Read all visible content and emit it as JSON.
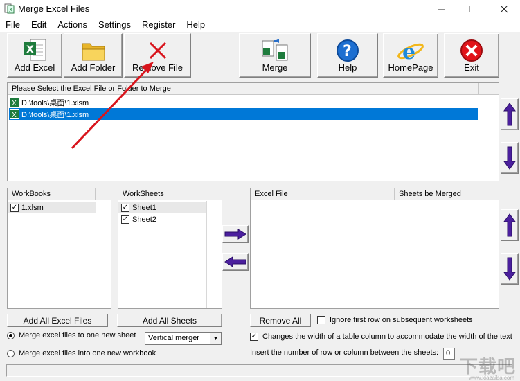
{
  "window": {
    "title": "Merge Excel Files"
  },
  "menu": [
    "File",
    "Edit",
    "Actions",
    "Settings",
    "Register",
    "Help"
  ],
  "toolbar": {
    "add_excel": "Add Excel",
    "add_folder": "Add Folder",
    "remove_file": "Remove File",
    "merge": "Merge",
    "help": "Help",
    "homepage": "HomePage",
    "exit": "Exit"
  },
  "files_panel": {
    "header": "Please Select the Excel File or Folder to Merge",
    "rows": [
      "D:\\tools\\桌面\\1.xlsm",
      "D:\\tools\\桌面\\1.xlsm"
    ],
    "selected_index": 1
  },
  "workbooks": {
    "header": "WorkBooks",
    "rows": [
      "1.xlsm"
    ]
  },
  "worksheets": {
    "header": "WorkSheets",
    "rows": [
      "Sheet1",
      "Sheet2"
    ]
  },
  "merge_list": {
    "col1": "Excel File",
    "col2": "Sheets be Merged"
  },
  "buttons": {
    "add_all_excel": "Add All Excel Files",
    "add_all_sheets": "Add All Sheets",
    "remove_all": "Remove All"
  },
  "options": {
    "ignore_first_row": "Ignore first row on subsequent worksheets",
    "ignore_first_row_checked": false,
    "change_width": "Changes the width of a table column to accommodate the width of the text",
    "change_width_checked": true,
    "merge_one_sheet": "Merge excel files to one new sheet",
    "merge_one_workbook": "Merge excel files into one new workbook",
    "merge_mode_selected": "one_sheet",
    "merger_type": "Vertical merger",
    "insert_rows_label": "Insert the number of row or column between the sheets:",
    "insert_rows_value": "0"
  },
  "watermark": {
    "main": "下载吧",
    "sub": "www.xiazaiba.com"
  },
  "colors": {
    "selection": "#0078d7",
    "arrow_purple": "#4b1f9e",
    "annotation_red": "#d8141c"
  }
}
